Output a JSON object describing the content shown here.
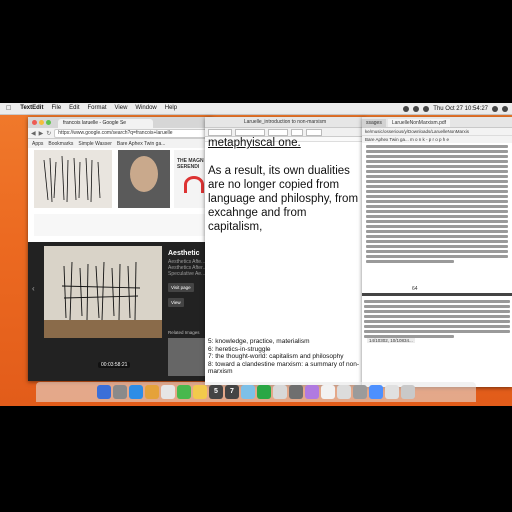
{
  "menubar": {
    "apple": "",
    "app_name": "TextEdit",
    "items": [
      "File",
      "Edit",
      "Format",
      "View",
      "Window",
      "Help"
    ],
    "clock": "Thu Oct 27  10:54:27"
  },
  "chrome": {
    "tab_title": "francois laruelle - Google Se",
    "url": "https://www.google.com/search?q=francois+laruelle",
    "bookmarks": [
      "Apps",
      "Bookmarks",
      "Simple Wasser",
      "Bare Aphex Twin ga..."
    ],
    "viewer": {
      "title": "Aesthetic",
      "subtitle_lines": [
        "Aesthetics Afte...",
        "Aesthetics After...",
        "Speculative Ae..."
      ],
      "visit_label": "Visit page",
      "view_label": "View",
      "related_label": "Related Images",
      "timestamp": "00:03:58:21"
    },
    "book_cover_text": [
      "THE MAGN",
      "SERENDI"
    ]
  },
  "textedit": {
    "title": "Laruelle_introduction to non-marxism",
    "heading": "metaphyiscal one.",
    "paragraph": "As a result, its own dualities are no longer copied from language and philosphy, from excahnge and from capitalism,",
    "list": [
      "5: knowledge, practice, materialism",
      "6: heretics-in-struggle",
      "7: the thought-world: capitalism and philosophy",
      "8: toward a clandestine marxism: a summary of non-marxism"
    ]
  },
  "pdf": {
    "tabs": [
      "ssages",
      "LaruelleNonMarxism.pdf"
    ],
    "url": "ke/music/osserious/y/Downloads/LaruelleNonMarxis",
    "bookmarks": "Bare Aphex Twin ga...   m o n k - p r o p h e",
    "page_number": "64",
    "progress_label": "14/10302, 10/10834..."
  },
  "dock": {
    "badge_number": "5",
    "badge_number_2": "7"
  }
}
